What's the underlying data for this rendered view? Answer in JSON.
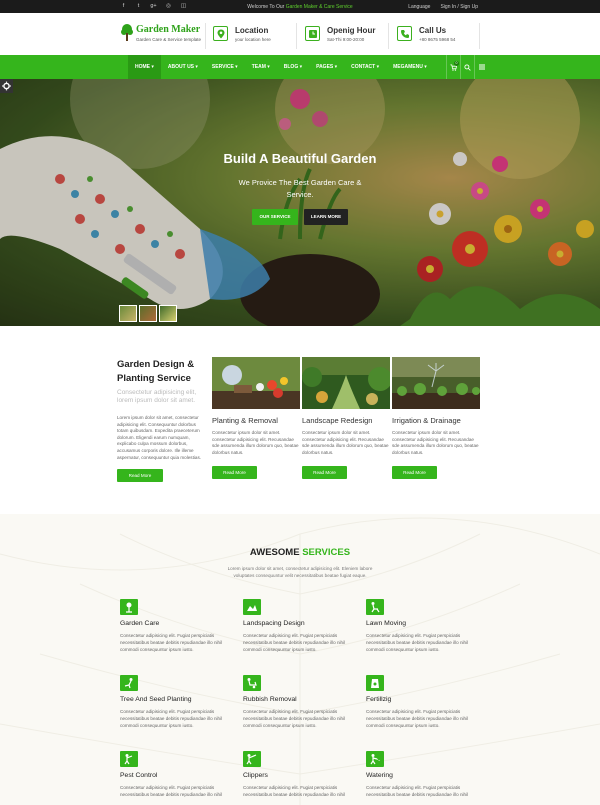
{
  "topbar": {
    "welcome_prefix": "Welcome To Our",
    "welcome_highlight": "Garden Maker & Care Service",
    "language": "Language",
    "signin": "Sign In / Sign Up",
    "social_icons": [
      "facebook-icon",
      "twitter-icon",
      "google-plus-icon",
      "dribbble-icon",
      "instagram-icon"
    ]
  },
  "header": {
    "logo_name": "Garden Maker",
    "logo_tagline": "Garden Care & Service template",
    "location": {
      "title": "Location",
      "sub": "your location here"
    },
    "hours": {
      "title": "Openig Hour",
      "sub": "Sat-Thi 9:00-20:00"
    },
    "call": {
      "title": "Call Us",
      "sub": "+80 8675 5968 54"
    }
  },
  "nav": {
    "items": [
      "HOME ▾",
      "ABOUT US ▾",
      "SERVICE ▾",
      "TEAM ▾",
      "BLOG ▾",
      "PAGES ▾",
      "CONTACT ▾",
      "MEGAMENU ▾"
    ],
    "cart_count": "0"
  },
  "hero": {
    "title": "Build A Beautiful Garden",
    "subtitle": "We Provice The Best Garden Care & Service.",
    "btn_primary": "OUR SERVICE",
    "btn_secondary": "LEARN MORE"
  },
  "design": {
    "title": "Garden Design & Planting Service",
    "subtitle": "Consectetur adipisicing elit, lorem ipsum dolor sit amet.",
    "body": "Lorem ipsum dolor sit amet, consectetur adipisicing elit. Consequuntur dolorbus totam quibusdam. Expedita praeceterum dolorum. Eligendi earum numquam, explicabo culpa mossum dolorbus, accusamus corporis dolore. Ille illeme aspernatur, consequuntur quia molestias.",
    "read_more": "Read More",
    "cards": [
      {
        "title": "Planting & Removal",
        "text": "Consectetur ipsum dolor sit amet. consectetur adipisicing elit. Recusandae sde assumenda illum dolorum quo, beatae dolorbus natus.",
        "read_more": "Read More"
      },
      {
        "title": "Landscape Redesign",
        "text": "Consectetur ipsum dolor sit amet. consectetur adipisicing elit. Recusandae sde assumenda illum dolorum quo, beatae dolorbus natus.",
        "read_more": "Read More"
      },
      {
        "title": "Irrigation & Drainage",
        "text": "Consectetur ipsum dolor sit amet. consectetur adipisicing elit. Recusandae sde assumenda illum dolorum quo, beatae dolorbus natus.",
        "read_more": "Read More"
      }
    ]
  },
  "services": {
    "heading_plain": "AWESOME",
    "heading_green": "SERVICES",
    "intro": "Lorem ipsum dolor sit amet, consectetur adipisicing elit. Eleniem labore voluptates consequuntur velit necessitatibus beatae fugiat eaque.",
    "items": [
      {
        "title": "Garden Care",
        "icon": "garden-care-icon",
        "text": "Consectetur adipisicing elit. Fugiat perspiciatis necessitatibus beatae debitis repudiandae illo nihil commodi consequuntur ipsum iusto."
      },
      {
        "title": "Landspacing Design",
        "icon": "landscaping-icon",
        "text": "Consectetur adipisicing elit. Fugiat perspiciatis necessitatibus beatae debitis repudiandae illo nihil commodi consequuntur ipsum iusto."
      },
      {
        "title": "Lawn Moving",
        "icon": "lawn-mower-icon",
        "text": "Consectetur adipisicing elit. Fugiat perspiciatis necessitatibus beatae debitis repudiandae illo nihil commodi consequuntur ipsum iusto."
      },
      {
        "title": "Tree And Seed Planting",
        "icon": "planting-icon",
        "text": "Consectetur adipisicing elit. Fugiat perspiciatis necessitatibus beatae debitis repudiandae illo nihil commodi consequuntur ipsum iusto."
      },
      {
        "title": "Rubbish Removal",
        "icon": "wheelbarrow-icon",
        "text": "Consectetur adipisicing elit. Fugiat perspiciatis necessitatibus beatae debitis repudiandae illo nihil commodi consequuntur ipsum iusto."
      },
      {
        "title": "Fertillzig",
        "icon": "fertilizer-icon",
        "text": "Consectetur adipisicing elit. Fugiat perspiciatis necessitatibus beatae debitis repudiandae illo nihil commodi consequuntur ipsum iusto."
      },
      {
        "title": "Pest Control",
        "icon": "pest-control-icon",
        "text": "Consectetur adipisicing elit. Fugiat perspiciatis necessitatibus beatae debitis repudiandae illo nihil"
      },
      {
        "title": "Clippers",
        "icon": "clippers-icon",
        "text": "Consectetur adipisicing elit. Fugiat perspiciatis necessitatibus beatae debitis repudiandae illo nihil"
      },
      {
        "title": "Watering",
        "icon": "watering-icon",
        "text": "Consectetur adipisicing elit. Fugiat perspiciatis necessitatibus beatae debitis repudiandae illo nihil"
      }
    ]
  },
  "colors": {
    "accent": "#35b51c",
    "topbar": "#1b1b1b",
    "dark_button": "#222222"
  }
}
